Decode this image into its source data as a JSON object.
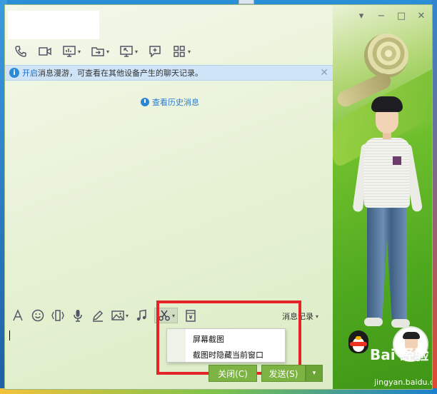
{
  "window": {
    "controls": {
      "menu": "▾",
      "minimize": "−",
      "maximize": "□",
      "close": "✕"
    }
  },
  "toolbar": {
    "icons": [
      "phone-icon",
      "video-icon",
      "screen-share-icon",
      "file-transfer-icon",
      "remote-desktop-icon",
      "message-plus-icon",
      "apps-grid-icon"
    ]
  },
  "notice": {
    "link": "开启",
    "text": "消息漫游，可查看在其他设备产生的聊天记录。",
    "close": "✕"
  },
  "history": {
    "label": "查看历史消息"
  },
  "input_toolbar": {
    "icons": [
      "font-icon",
      "emoji-icon",
      "shake-icon",
      "voice-icon",
      "pen-icon",
      "image-icon",
      "music-icon",
      "scissors-icon",
      "red-packet-icon"
    ],
    "message_record": "消息记录"
  },
  "screenshot_menu": {
    "items": [
      "屏幕截图",
      "截图时隐藏当前窗口"
    ]
  },
  "buttons": {
    "close": "关闭(C)",
    "send": "发送(S)",
    "send_menu": "▾"
  },
  "watermark": {
    "brand": "Bai 经验",
    "url": "jingyan.baidu.com"
  },
  "colors": {
    "accent_green": "#7cb342",
    "highlight_red": "#e52427",
    "notice_blue": "#cfe4f7",
    "link_blue": "#1f6ec7"
  }
}
